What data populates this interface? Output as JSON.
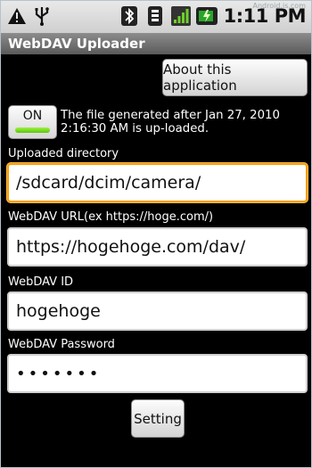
{
  "statusbar": {
    "time": "1:11 PM",
    "watermark": "Android.is.com",
    "icons": [
      "warning-icon",
      "usb-icon",
      "bluetooth-icon",
      "vibrate-icon",
      "signal-icon",
      "battery-icon"
    ]
  },
  "app": {
    "title": "WebDAV Uploader"
  },
  "about_button": "About this application",
  "toggle": {
    "label": "ON",
    "state": "on"
  },
  "description": "The file generated after Jan 27, 2010 2:16:30 AM is up-loaded.",
  "fields": {
    "directory": {
      "label": "Uploaded directory",
      "value": "/sdcard/dcim/camera/"
    },
    "url": {
      "label": "WebDAV URL(ex https://hoge.com/)",
      "value": "https://hogehoge.com/dav/"
    },
    "id": {
      "label": "WebDAV ID",
      "value": "hogehoge"
    },
    "password": {
      "label": "WebDAV Password",
      "value": "•••••••"
    }
  },
  "setting_button": "Setting",
  "colors": {
    "toggle_on": "#7ad321",
    "focus": "#ff9d00"
  }
}
